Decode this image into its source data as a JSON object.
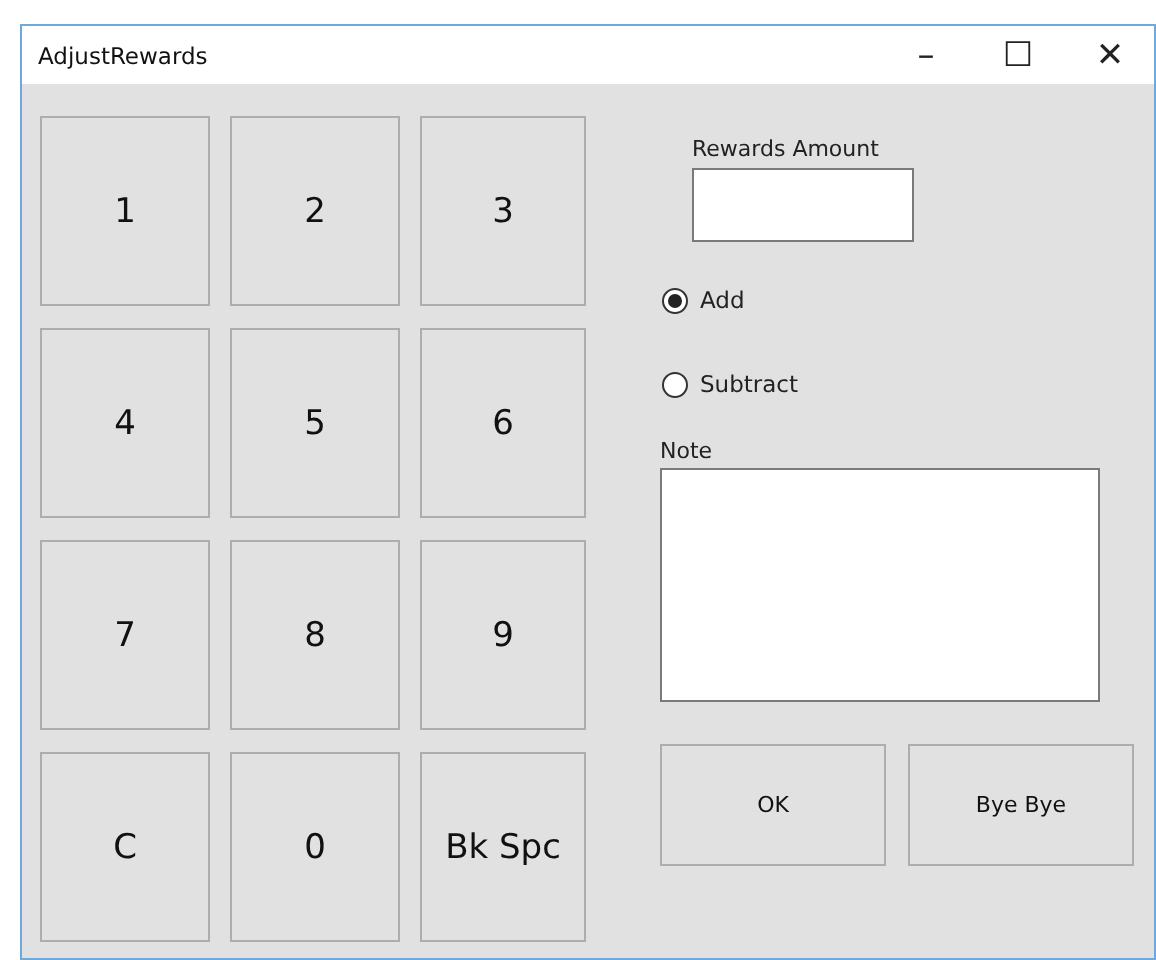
{
  "window": {
    "title": "AdjustRewards",
    "controls": [
      "–",
      "☐",
      "✕"
    ]
  },
  "keypad": [
    "1",
    "2",
    "3",
    "4",
    "5",
    "6",
    "7",
    "8",
    "9",
    "C",
    "0",
    "Bk Spc"
  ],
  "rewards_amount": {
    "label": "Rewards Amount"
  },
  "radios": [
    {
      "label": "Add",
      "selected": true
    },
    {
      "label": "Subtract",
      "selected": false
    }
  ],
  "note": {
    "label": "Note"
  },
  "buttons": [
    "OK",
    "Bye Bye"
  ]
}
